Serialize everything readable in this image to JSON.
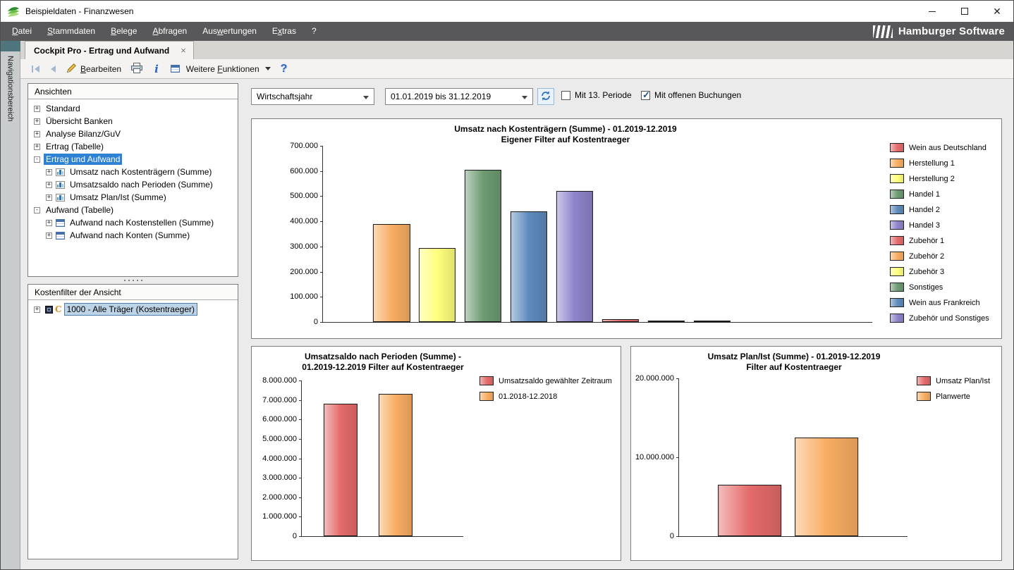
{
  "window": {
    "title": "Beispieldaten - Finanzwesen",
    "controls": {
      "close": "✕"
    }
  },
  "brand": {
    "name": "Hamburger Software"
  },
  "menu": {
    "items": [
      {
        "label": "Datei",
        "u": 0
      },
      {
        "label": "Stammdaten",
        "u": 0
      },
      {
        "label": "Belege",
        "u": 0
      },
      {
        "label": "Abfragen",
        "u": 0
      },
      {
        "label": "Auswertungen",
        "u": 3
      },
      {
        "label": "Extras",
        "u": 1
      },
      {
        "label": "?",
        "u": -1
      }
    ]
  },
  "nav_strip": {
    "label": "Navigationsbereich"
  },
  "tab": {
    "label": "Cockpit Pro - Ertrag und Aufwand",
    "close_glyph": "×"
  },
  "toolbar": {
    "edit": {
      "label": "Bearbeiten",
      "u": 0
    },
    "more": {
      "label": "Weitere Funktionen",
      "u": 8
    },
    "info_glyph": "i",
    "help_glyph": "?"
  },
  "ansichten": {
    "title": "Ansichten",
    "items": [
      {
        "label": "Standard",
        "level": 0,
        "toggle": "+"
      },
      {
        "label": "Übersicht Banken",
        "level": 0,
        "toggle": "+"
      },
      {
        "label": "Analyse Bilanz/GuV",
        "level": 0,
        "toggle": "+"
      },
      {
        "label": "Ertrag (Tabelle)",
        "level": 0,
        "toggle": "+"
      },
      {
        "label": "Ertrag und Aufwand",
        "level": 0,
        "toggle": "-",
        "selected": true
      },
      {
        "label": "Umsatz nach Kostenträgern (Summe)",
        "level": 1,
        "toggle": "+",
        "icon": "bar-chart"
      },
      {
        "label": "Umsatzsaldo nach Perioden (Summe)",
        "level": 1,
        "toggle": "+",
        "icon": "bar-chart"
      },
      {
        "label": "Umsatz Plan/Ist (Summe)",
        "level": 1,
        "toggle": "+",
        "icon": "bar-chart"
      },
      {
        "label": "Aufwand (Tabelle)",
        "level": 0,
        "toggle": "-"
      },
      {
        "label": "Aufwand nach Kostenstellen (Summe)",
        "level": 1,
        "toggle": "+",
        "icon": "table"
      },
      {
        "label": "Aufwand nach Konten (Summe)",
        "level": 1,
        "toggle": "+",
        "icon": "table"
      }
    ]
  },
  "kostenfilter": {
    "title": "Kostenfilter der Ansicht",
    "item": {
      "label": "1000 - Alle Träger (Kostentraeger)",
      "toggle": "+",
      "icon_glyph": "C"
    }
  },
  "filters": {
    "period_type": "Wirtschaftsjahr",
    "period_range": "01.01.2019 bis 31.12.2019",
    "with_13_periode": {
      "label": "Mit 13. Periode",
      "checked": false
    },
    "with_open_bookings": {
      "label": "Mit offenen Buchungen",
      "checked": true
    }
  },
  "chart_data": [
    {
      "type": "bar",
      "title": "Umsatz nach Kostenträgern (Summe) - 01.2019-12.2019",
      "subtitle": "Eigener Filter auf Kostentraeger",
      "categories": [
        "Wein aus Deutschland",
        "Herstellung 1",
        "Herstellung 2",
        "Handel 1",
        "Handel 2",
        "Handel 3",
        "Zubehör 1",
        "Zubehör 2",
        "Zubehör 3",
        "Sonstiges",
        "Wein aus Frankreich",
        "Zubehör und Sonstiges"
      ],
      "values": [
        0,
        390000,
        295000,
        605000,
        440000,
        520000,
        12000,
        5000,
        7000,
        0,
        0,
        0
      ],
      "colors": [
        "#e46a6a",
        "#f8ad62",
        "#ffff7d",
        "#6d9b72",
        "#5e8abc",
        "#8d83cb",
        "#e46a6a",
        "#f8ad62",
        "#ffff7d",
        "#6d9b72",
        "#5e8abc",
        "#8d83cb"
      ],
      "ylim": [
        0,
        700000
      ],
      "ytick_step": 100000,
      "bar_width": 0.067,
      "grid": false,
      "legend_position": "right"
    },
    {
      "type": "bar",
      "title": "Umsatzsaldo nach Perioden (Summe) -",
      "subtitle": "01.2019-12.2019 Filter auf Kostentraeger",
      "series": [
        {
          "name": "Umsatzsaldo gewählter Zeitraum",
          "value": 6800000,
          "color": "#e46a6a",
          "x_frac": 0.24
        },
        {
          "name": "01.2018-12.2018",
          "value": 7300000,
          "color": "#f8ad62",
          "x_frac": 0.58
        }
      ],
      "ylim": [
        0,
        8000000
      ],
      "ytick_step": 1000000,
      "bar_width": 0.21,
      "grid": false,
      "legend_position": "right"
    },
    {
      "type": "bar",
      "title": "Umsatz Plan/Ist (Summe) - 01.2019-12.2019",
      "subtitle": "Filter auf Kostentraeger",
      "series": [
        {
          "name": "Umsatz Plan/Ist",
          "value": 6500000,
          "color": "#e46a6a",
          "x_frac": 0.31
        },
        {
          "name": "Planwerte",
          "value": 12500000,
          "color": "#f8ad62",
          "x_frac": 0.646
        }
      ],
      "ylim": [
        0,
        20000000
      ],
      "ytick_step": 10000000,
      "bar_width": 0.277,
      "grid": false,
      "legend_position": "right"
    }
  ]
}
